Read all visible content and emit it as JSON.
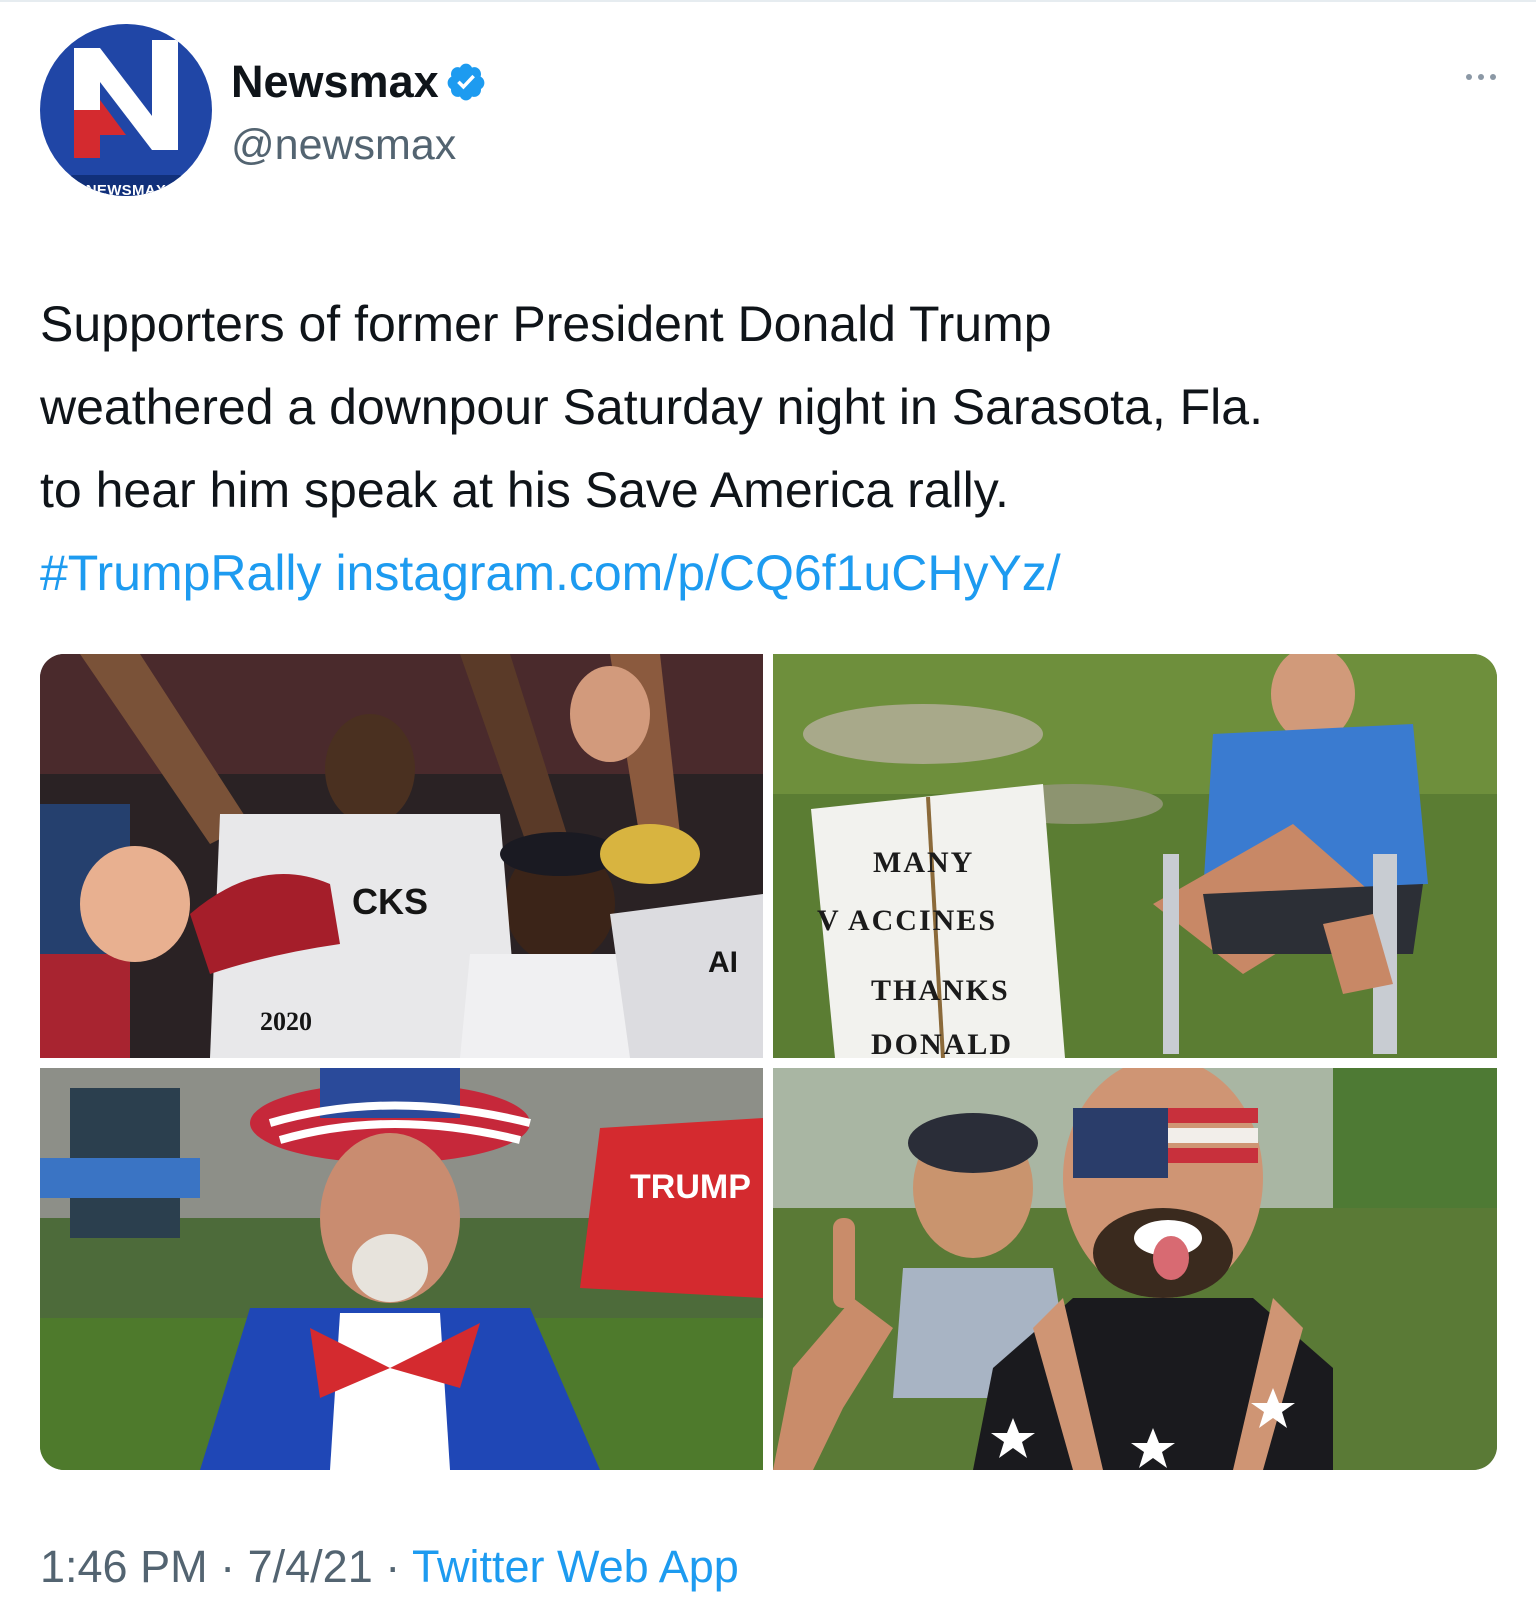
{
  "account": {
    "display_name": "Newsmax",
    "handle": "@newsmax",
    "avatar_badge": "NEWSMAX",
    "avatar_letter": "N",
    "verified": true
  },
  "tweet": {
    "text_lines": [
      "Supporters of former President Donald Trump",
      "weathered a downpour Saturday night in Sarasota, Fla.",
      "to hear him speak at his Save America rally."
    ],
    "hashtag": "#TrumpRally",
    "link": "instagram.com/p/CQ6f1uCHyYz/"
  },
  "photos": {
    "p1_shirt_text_1": "CKS",
    "p1_shirt_text_2": "2020",
    "p1_shirt_text_3": "AI",
    "p2_sign_line_1": "MANY",
    "p2_sign_line_2": "V ACCINES",
    "p2_sign_line_3": "THANKS",
    "p2_sign_line_4": "DONALD",
    "p3_shirt_text": "TRUMP"
  },
  "footer": {
    "time": "1:46 PM",
    "date": "7/4/21",
    "separator": "·",
    "source": "Twitter Web App"
  },
  "colors": {
    "link_blue": "#1d9bf0",
    "secondary_text": "#536471",
    "brand_blue": "#2046a6",
    "brand_red": "#d42a2f"
  },
  "icons": {
    "verified": "verified-badge-icon",
    "more": "more-options-icon"
  }
}
